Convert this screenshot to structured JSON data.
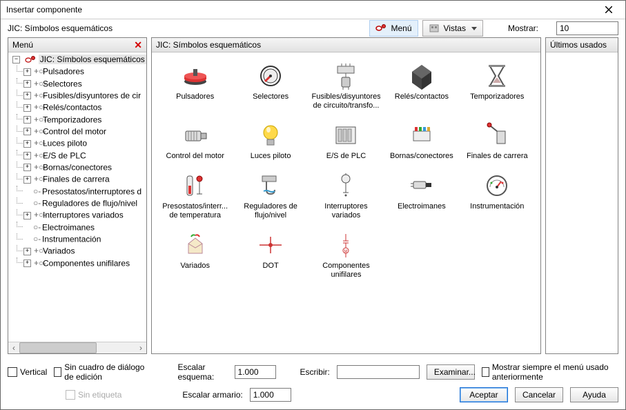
{
  "window": {
    "title": "Insertar componente"
  },
  "subtitle": "JIC: Símbolos esquemáticos",
  "toolbar": {
    "menuBtn": "Menú",
    "viewsBtn": "Vistas",
    "showLabel": "Mostrar:",
    "showValue": "10"
  },
  "panels": {
    "menuTitle": "Menú",
    "mainTitle": "JIC: Símbolos esquemáticos",
    "recentTitle": "Últimos usados"
  },
  "tree": {
    "root": "JIC: Símbolos esquemáticos",
    "items": [
      {
        "label": "Pulsadores",
        "exp": true
      },
      {
        "label": "Selectores",
        "exp": true
      },
      {
        "label": "Fusibles/disyuntores de circuito/transfo...",
        "exp": true,
        "clip": "Fusibles/disyuntores de cir"
      },
      {
        "label": "Relés/contactos",
        "exp": true
      },
      {
        "label": "Temporizadores",
        "exp": true
      },
      {
        "label": "Control del motor",
        "exp": true
      },
      {
        "label": "Luces piloto",
        "exp": true
      },
      {
        "label": "E/S de PLC",
        "exp": true
      },
      {
        "label": "Bornas/conectores",
        "exp": true
      },
      {
        "label": "Finales de carrera",
        "exp": true
      },
      {
        "label": "Presostatos/interruptores d",
        "exp": false
      },
      {
        "label": "Reguladores de flujo/nivel",
        "exp": false
      },
      {
        "label": "Interruptores variados",
        "exp": true
      },
      {
        "label": "Electroimanes",
        "exp": false
      },
      {
        "label": "Instrumentación",
        "exp": false
      },
      {
        "label": "Variados",
        "exp": true
      },
      {
        "label": "Componentes unifilares",
        "exp": true
      }
    ]
  },
  "grid": {
    "items": [
      {
        "id": "pulsadores",
        "label": "Pulsadores"
      },
      {
        "id": "selectores",
        "label": "Selectores"
      },
      {
        "id": "fusibles",
        "label": "Fusibles/disyuntores de circuito/transfo..."
      },
      {
        "id": "reles",
        "label": "Relés/contactos"
      },
      {
        "id": "temporizadores",
        "label": "Temporizadores"
      },
      {
        "id": "controlmotor",
        "label": "Control del motor"
      },
      {
        "id": "lucespiloto",
        "label": "Luces piloto"
      },
      {
        "id": "esplc",
        "label": "E/S de PLC"
      },
      {
        "id": "bornas",
        "label": "Bornas/conectores"
      },
      {
        "id": "finales",
        "label": "Finales de carrera"
      },
      {
        "id": "presostatos",
        "label": "Presostatos/interr... de temperatura"
      },
      {
        "id": "reguladores",
        "label": "Reguladores de flujo/nivel"
      },
      {
        "id": "interruptores",
        "label": "Interruptores variados"
      },
      {
        "id": "electroimanes",
        "label": "Electroimanes"
      },
      {
        "id": "instrumentacion",
        "label": "Instrumentación"
      },
      {
        "id": "variados",
        "label": "Variados"
      },
      {
        "id": "dot",
        "label": "DOT"
      },
      {
        "id": "unifilares",
        "label": "Componentes unifilares"
      }
    ]
  },
  "bottom": {
    "verticalChk": "Vertical",
    "noDialogChk": "Sin cuadro de diálogo de edición",
    "noLabelChk": "Sin etiqueta",
    "scaleSchemaLbl": "Escalar esquema:",
    "scaleSchemaVal": "1.000",
    "scalePanelLbl": "Escalar armario:",
    "scalePanelVal": "1.000",
    "typeLbl": "Escribir:",
    "typeVal": "",
    "browseBtn": "Examinar...",
    "alwaysShowChk": "Mostrar siempre el menú usado anteriormente",
    "okBtn": "Aceptar",
    "cancelBtn": "Cancelar",
    "helpBtn": "Ayuda"
  },
  "icons": {
    "pulsadores": "<svg viewBox='0 0 40 40'><ellipse cx='20' cy='28' rx='16' ry='5' fill='#444'/><ellipse cx='20' cy='24' rx='16' ry='5' fill='#d33'/><rect x='4' y='20' width='32' height='5' fill='#d33'/><ellipse cx='20' cy='20' rx='16' ry='5' fill='#e55'/><rect x='17' y='10' width='6' height='10' fill='#555'/></svg>",
    "selectores": "<svg viewBox='0 0 40 40'><circle cx='20' cy='20' r='14' fill='#fff' stroke='#333' stroke-width='2'/><circle cx='20' cy='20' r='10' fill='#eee' stroke='#333'/><line x1='20' y1='20' x2='12' y2='28' stroke='#d33' stroke-width='3'/><circle cx='20' cy='20' r='2' fill='#333'/></svg>",
    "fusibles": "<svg viewBox='0 0 40 40'><rect x='8' y='6' width='24' height='10' fill='#ddd' stroke='#666'/><line x1='14' y1='6' x2='14' y2='2' stroke='#666'/><line x1='20' y1='6' x2='20' y2='2' stroke='#666'/><line x1='26' y1='6' x2='26' y2='2' stroke='#666'/><rect x='14' y='22' width='12' height='14' rx='2' fill='#ccc' stroke='#555'/><line x1='20' y1='16' x2='20' y2='22' stroke='#666'/><line x1='16' y1='36' x2='16' y2='40' stroke='#666'/><line x1='24' y1='36' x2='24' y2='40' stroke='#666'/></svg>",
    "reles": "<svg viewBox='0 0 40 40'><path d='M 20 4 L 34 14 L 34 30 L 20 40 L 6 30 L 6 14 Z' fill='#444'/><path d='M 20 4 L 34 14 L 20 24 L 6 14 Z' fill='#666'/><path d='M 20 24 L 34 14 L 34 30 L 20 40 Z' fill='#333'/></svg>",
    "temporizadores": "<svg viewBox='0 0 40 40'><path d='M 10 6 L 30 6 L 22 20 L 30 34 L 10 34 L 18 20 Z' fill='none' stroke='#555' stroke-width='2'/><rect x='8' y='4' width='24' height='3' fill='#888'/><rect x='8' y='33' width='24' height='3' fill='#888'/><path d='M 14 30 L 26 30 L 20 22 Z' fill='#caa'/></svg>",
    "controlmotor": "<svg viewBox='0 0 40 40'><rect x='6' y='14' width='22' height='14' rx='2' fill='#ddd' stroke='#555'/><rect x='28' y='17' width='8' height='8' fill='#bbb' stroke='#555'/><line x1='10' y1='14' x2='10' y2='28' stroke='#888'/><line x1='14' y1='14' x2='14' y2='28' stroke='#888'/><line x1='18' y1='14' x2='18' y2='28' stroke='#888'/><line x1='22' y1='14' x2='22' y2='28' stroke='#888'/></svg>",
    "lucespiloto": "<svg viewBox='0 0 40 40'><circle cx='20' cy='16' r='10' fill='#ffd94a' stroke='#c9a400'/><rect x='15' y='26' width='10' height='8' fill='#bbb' stroke='#777'/><ellipse cx='17' cy='12' rx='3' ry='4' fill='#fff' opacity='0.7'/></svg>",
    "esplc": "<svg viewBox='0 0 40 40'><rect x='6' y='8' width='28' height='24' fill='#eee' stroke='#555'/><rect x='9' y='11' width='5' height='18' fill='#ccc' stroke='#888'/><rect x='16' y='11' width='5' height='18' fill='#ccc' stroke='#888'/><rect x='23' y='11' width='5' height='18' fill='#ccc' stroke='#888'/></svg>",
    "bornas": "<svg viewBox='0 0 40 40'><rect x='8' y='14' width='24' height='14' fill='#eee' stroke='#666'/><rect x='10' y='8' width='4' height='6' fill='#d33'/><rect x='16' y='8' width='4' height='6' fill='#3a3'/><rect x='22' y='8' width='4' height='6' fill='#39d'/><rect x='28' y='8' width='4' height='6' fill='#da3'/></svg>",
    "finales": "<svg viewBox='0 0 40 40'><rect x='20' y='14' width='12' height='18' fill='#ddd' stroke='#555'/><line x1='20' y1='14' x2='10' y2='6' stroke='#555' stroke-width='2'/><circle cx='9' cy='5' r='3' fill='#d33' stroke='#800'/></svg>",
    "presostatos": "<svg viewBox='0 0 40 40'><rect x='8' y='6' width='8' height='28' rx='3' fill='#eee' stroke='#555'/><rect x='10' y='20' width='4' height='12' fill='#d33'/><circle cx='26' cy='10' r='4' fill='#d33' stroke='#800'/><line x1='26' y1='14' x2='26' y2='32' stroke='#555'/><line x1='22' y1='32' x2='30' y2='32' stroke='#555'/></svg>",
    "reguladores": "<svg viewBox='0 0 40 40'><rect x='8' y='6' width='20' height='8' fill='#ccc' stroke='#666'/><path d='M 14 14 L 14 26 Q 14 32 20 32 Q 26 32 26 26' fill='none' stroke='#666' stroke-width='2'/><path d='M 10 28 Q 14 26 18 28 Q 22 30 26 28' fill='none' stroke='#39c' stroke-width='2'/></svg>",
    "interruptores": "<svg viewBox='0 0 40 40'><circle cx='20' cy='10' r='6' fill='#eee' stroke='#555'/><line x1='20' y1='4' x2='20' y2='2' stroke='#555'/><line x1='20' y1='16' x2='20' y2='30' stroke='#555'/><line x1='16' y1='30' x2='24' y2='30' stroke='#555'/><circle cx='20' cy='34' r='1.5' fill='#555'/></svg>",
    "electroimanes": "<svg viewBox='0 0 40 40'><rect x='8' y='14' width='18' height='10' rx='2' fill='#ddd' stroke='#555'/><rect x='26' y='16' width='8' height='6' fill='#333'/><line x1='8' y1='17' x2='4' y2='17' stroke='#555'/><line x1='8' y1='21' x2='4' y2='21' stroke='#555'/></svg>",
    "instrumentacion": "<svg viewBox='0 0 40 40'><circle cx='20' cy='20' r='14' fill='#fff' stroke='#555' stroke-width='2'/><path d='M 10 22 A 10 10 0 0 1 30 22' fill='none' stroke='#888'/><line x1='20' y1='22' x2='26' y2='14' stroke='#d33' stroke-width='2'/><circle cx='20' cy='22' r='2' fill='#333'/><circle cx='12' cy='16' r='1.5' fill='#3a3'/><circle cx='28' cy='16' r='1.5' fill='#d33'/></svg>",
    "variados": "<svg viewBox='0 0 40 40'><path d='M 10 18 L 20 10 L 30 18 L 30 32 L 10 32 Z' fill='#f5e9c8' stroke='#b89'/><path d='M 10 18 L 20 24 L 30 18' fill='none' stroke='#b89'/><path d='M 14 8 Q 16 4 20 6' fill='none' stroke='#3a3' stroke-width='2'/><path d='M 26 8 Q 24 4 20 6' fill='none' stroke='#d33' stroke-width='2'/></svg>",
    "dot": "<svg viewBox='0 0 40 40'><line x1='4' y1='20' x2='36' y2='20' stroke='#c33' stroke-width='1.5'/><line x1='20' y1='8' x2='20' y2='32' stroke='#c33' stroke-width='1.5'/><circle cx='20' cy='20' r='3' fill='#c33'/></svg>",
    "unifilares": "<svg viewBox='0 0 40 40'><line x1='20' y1='4' x2='20' y2='14' stroke='#c33'/><line x1='16' y1='14' x2='24' y2='14' stroke='#c33'/><line x1='16' y1='17' x2='24' y2='17' stroke='#c33'/><line x1='20' y1='17' x2='20' y2='24' stroke='#c33'/><circle cx='20' cy='28' r='4' fill='none' stroke='#c33'/><text x='20' y='31' font-size='6' text-anchor='middle' fill='#c33'>M</text><line x1='20' y1='32' x2='20' y2='38' stroke='#c33'/></svg>",
    "menuicon": "<svg viewBox='0 0 16 16'><ellipse cx='5' cy='8' rx='4' ry='3' fill='#fff' stroke='#b00' stroke-width='1.5'/><circle cx='12' cy='5' r='2.5' fill='#d33' stroke='#800'/></svg>",
    "viewsicon": "<svg viewBox='0 0 16 16'><rect x='2' y='3' width='12' height='10' fill='#ccc' stroke='#888'/><rect x='4' y='5' width='3' height='3' fill='#888'/><rect x='9' y='5' width='3' height='3' fill='#888'/></svg>",
    "rooticon": "<svg viewBox='0 0 16 16'><ellipse cx='5' cy='8' rx='4' ry='3' fill='#fff' stroke='#b00' stroke-width='1.2'/><circle cx='12' cy='5' r='2.5' fill='#d33' stroke='#800'/></svg>"
  }
}
